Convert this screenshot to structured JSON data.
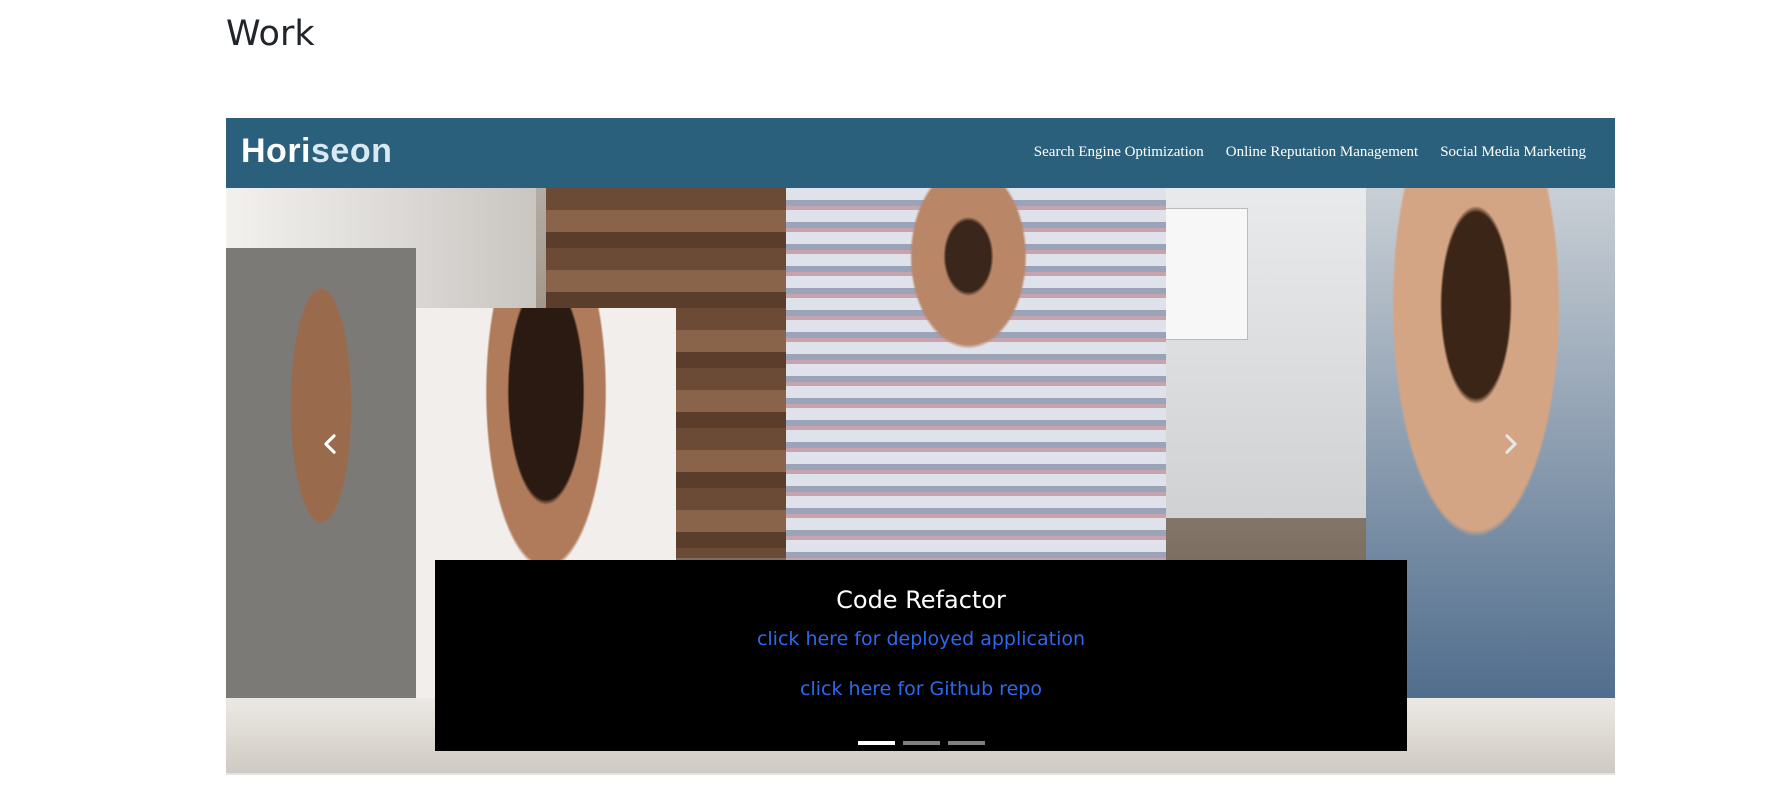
{
  "section": {
    "title": "Work"
  },
  "slide": {
    "site_logo": "Horiseon",
    "site_logo_part1": "Hori",
    "site_logo_part2": "seon",
    "site_nav": [
      "Search Engine Optimization",
      "Online Reputation Management",
      "Social Media Marketing"
    ]
  },
  "caption": {
    "title": "Code Refactor",
    "deployed_link": "click here for deployed application",
    "repo_link": "click here for Github repo"
  },
  "carousel": {
    "slide_count": 3,
    "active_index": 0
  },
  "icons": {
    "prev": "chevron-left-icon",
    "next": "chevron-right-icon"
  },
  "colors": {
    "nav_bg": "#2a607c",
    "caption_bg": "#000000",
    "link": "#2c69f0"
  }
}
